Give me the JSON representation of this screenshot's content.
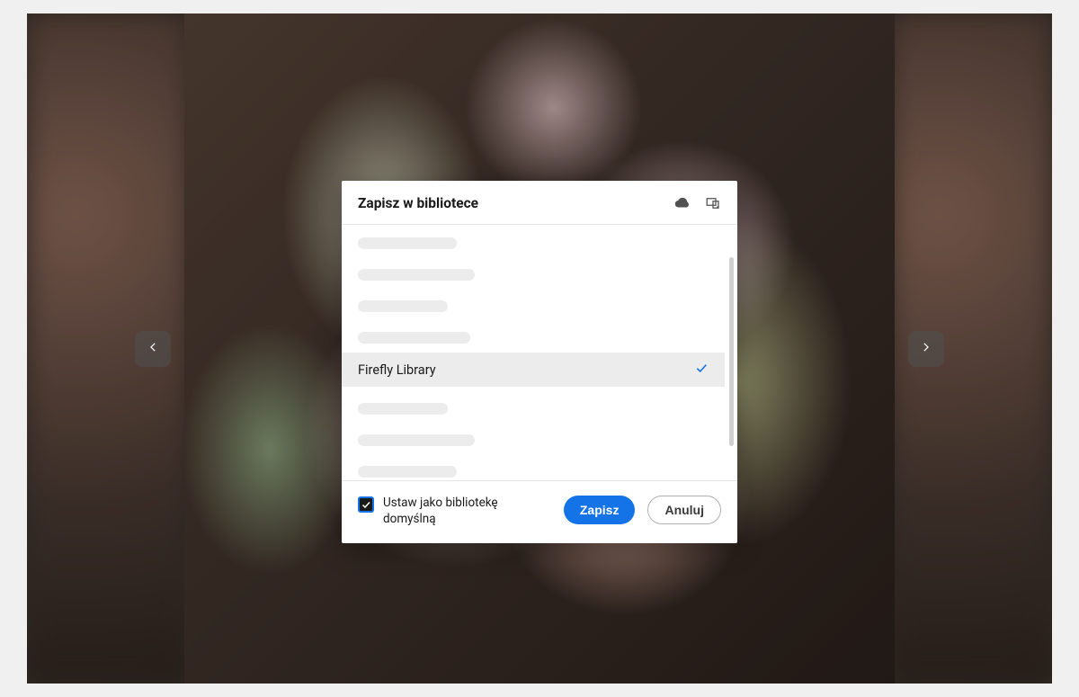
{
  "dialog": {
    "title": "Zapisz w bibliotece",
    "selected_library": "Firefly Library",
    "default_checkbox_label": "Ustaw jako bibliotekę domyślną",
    "default_checkbox_checked": true,
    "save_label": "Zapisz",
    "cancel_label": "Anuluj"
  },
  "icons": {
    "cloud": "cloud-icon",
    "devices": "devices-icon",
    "prev": "chevron-left-icon",
    "next": "chevron-right-icon",
    "check": "checkmark-icon"
  }
}
